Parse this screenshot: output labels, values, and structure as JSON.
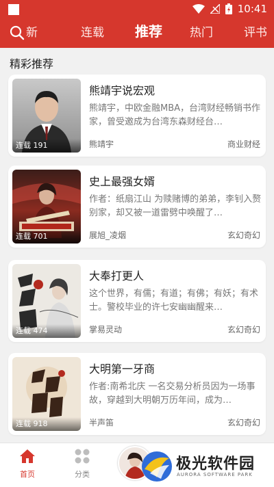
{
  "status_bar": {
    "time": "10:41"
  },
  "top_nav": {
    "tabs": [
      {
        "label": "新"
      },
      {
        "label": "连载"
      },
      {
        "label": "推荐"
      },
      {
        "label": "热门"
      },
      {
        "label": "评书"
      }
    ]
  },
  "section": {
    "title": "精彩推荐"
  },
  "books": [
    {
      "title": "熊靖宇说宏观",
      "badge": "连载 191",
      "desc": "熊靖宇，中欧金融MBA，台湾财经畅销书作家，曾受邀成为台湾东森财经台…",
      "author": "熊靖宇",
      "genre": "商业财经"
    },
    {
      "title": "史上最强女婿",
      "badge": "连载 701",
      "desc": "作者：纸扇江山 为赎赌博的弟弟，李钊入赘别家，却又被一道雷劈中唤醒了…",
      "author": "展旭_凌烟",
      "genre": "玄幻奇幻"
    },
    {
      "title": "大奉打更人",
      "badge": "连载 474",
      "desc": "这个世界，有儒；有道；有佛；有妖；有术士。警校毕业的许七安幽幽醒来…",
      "author": "掌易灵动",
      "genre": "玄幻奇幻"
    },
    {
      "title": "大明第一牙商",
      "badge": "连载 918",
      "desc": "作者:南希北庆 一名交易分析员因为一场事故，穿越到大明朝万历年间，成为…",
      "author": "半声笛",
      "genre": "玄幻奇幻"
    }
  ],
  "bottom_nav": {
    "home_label": "首页",
    "category_label": "分类"
  },
  "watermark": {
    "name": "极光软件园",
    "sub": "AURORA SOFTWARE PARK"
  },
  "colors": {
    "brand": "#d6372d"
  }
}
